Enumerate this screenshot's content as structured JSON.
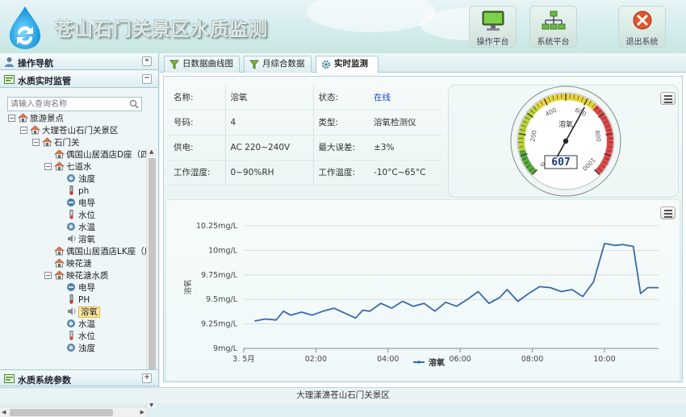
{
  "header": {
    "title": "苍山石门关景区水质监测",
    "buttons": [
      {
        "label": "操作平台",
        "icon": "monitor-icon"
      },
      {
        "label": "系统平台",
        "icon": "network-icon"
      },
      {
        "label": "退出系统",
        "icon": "close-icon"
      }
    ]
  },
  "sidebar": {
    "nav_title": "操作导航",
    "section_title": "水质实时监管",
    "bottom_section_title": "水质系统参数",
    "search_placeholder": "请输入查询名称",
    "tree": [
      {
        "label": "旅游景点",
        "level": 0,
        "toggle": "-",
        "icon": "home-icon"
      },
      {
        "label": "大理苍山石门关景区",
        "level": 1,
        "toggle": "-",
        "icon": "home-icon"
      },
      {
        "label": "石门关",
        "level": 2,
        "toggle": "-",
        "icon": "home-icon"
      },
      {
        "label": "偶国山居酒店D座（四",
        "level": 3,
        "toggle": "",
        "icon": "home-icon"
      },
      {
        "label": "七道水",
        "level": 3,
        "toggle": "-",
        "icon": "home-icon"
      },
      {
        "label": "浊度",
        "level": 4,
        "toggle": "",
        "icon": "turbidity-icon"
      },
      {
        "label": "ph",
        "level": 4,
        "toggle": "",
        "icon": "ph-icon"
      },
      {
        "label": "电导",
        "level": 4,
        "toggle": "",
        "icon": "conductivity-icon"
      },
      {
        "label": "水位",
        "level": 4,
        "toggle": "",
        "icon": "water-level-icon"
      },
      {
        "label": "水温",
        "level": 4,
        "toggle": "",
        "icon": "water-temp-icon"
      },
      {
        "label": "溶氧",
        "level": 4,
        "toggle": "",
        "icon": "oxygen-icon"
      },
      {
        "label": "偶国山居酒店LK座（层",
        "level": 3,
        "toggle": "",
        "icon": "home-icon"
      },
      {
        "label": "映花溏",
        "level": 3,
        "toggle": "",
        "icon": "home-icon"
      },
      {
        "label": "映花溏水质",
        "level": 3,
        "toggle": "-",
        "icon": "home-icon"
      },
      {
        "label": "电导",
        "level": 4,
        "toggle": "",
        "icon": "conductivity-icon"
      },
      {
        "label": "PH",
        "level": 4,
        "toggle": "",
        "icon": "ph-icon"
      },
      {
        "label": "溶氧",
        "level": 4,
        "toggle": "",
        "icon": "oxygen-icon",
        "selected": true
      },
      {
        "label": "水温",
        "level": 4,
        "toggle": "",
        "icon": "water-temp-icon"
      },
      {
        "label": "水位",
        "level": 4,
        "toggle": "",
        "icon": "water-level-icon"
      },
      {
        "label": "浊度",
        "level": 4,
        "toggle": "",
        "icon": "turbidity-icon"
      }
    ]
  },
  "tabs": [
    {
      "label": "日数据曲线图",
      "active": false
    },
    {
      "label": "月综合数据",
      "active": false
    },
    {
      "label": "实时监测",
      "active": true
    }
  ],
  "device_info": [
    {
      "label": "名称:",
      "value": "溶氧",
      "label2": "状态:",
      "value2": "在线"
    },
    {
      "label": "号码:",
      "value": "4",
      "label2": "类型:",
      "value2": "溶氧检测仪"
    },
    {
      "label": "供电:",
      "value": "AC 220~240V",
      "label2": "最大误差:",
      "value2": "±3%"
    },
    {
      "label": "工作湿度:",
      "value": "0~90%RH",
      "label2": "工作温度:",
      "value2": "-10°C~65°C"
    }
  ],
  "colors": {
    "status_online": "#1a3fd6",
    "series_line": "#3a6aa8",
    "accent": "#7fb8c8"
  },
  "gauge": {
    "title": "溶氧",
    "value": 607,
    "value_display": "607",
    "ticks": [
      "0",
      "200",
      "400",
      "600",
      "800",
      "1000"
    ],
    "max": 1000
  },
  "chart_data": {
    "type": "line",
    "title": "",
    "xlabel": "",
    "ylabel": "溶氧",
    "x_ticks": [
      "3. 5月",
      "02:00",
      "04:00",
      "06:00",
      "08:00",
      "10:00"
    ],
    "y_ticks": [
      "9mg/L",
      "9.25mg/L",
      "9.5mg/L",
      "9.75mg/L",
      "10mg/L",
      "10.25mg/L"
    ],
    "ylim": [
      9,
      10.25
    ],
    "xlim_hours": [
      0,
      11.5
    ],
    "series": [
      {
        "name": "溶氧",
        "x": [
          0.3,
          0.6,
          0.9,
          1.1,
          1.3,
          1.6,
          1.9,
          2.2,
          2.5,
          2.8,
          3.1,
          3.3,
          3.5,
          3.8,
          4.1,
          4.4,
          4.7,
          5.0,
          5.3,
          5.6,
          5.9,
          6.2,
          6.5,
          6.8,
          7.1,
          7.3,
          7.6,
          7.9,
          8.2,
          8.5,
          8.8,
          9.1,
          9.4,
          9.7,
          10.0,
          10.3,
          10.5,
          10.8,
          11.0,
          11.2,
          11.5
        ],
        "values": [
          9.28,
          9.3,
          9.29,
          9.38,
          9.34,
          9.37,
          9.34,
          9.38,
          9.41,
          9.36,
          9.31,
          9.39,
          9.38,
          9.46,
          9.41,
          9.48,
          9.43,
          9.46,
          9.38,
          9.47,
          9.43,
          9.5,
          9.58,
          9.46,
          9.52,
          9.6,
          9.48,
          9.56,
          9.63,
          9.62,
          9.58,
          9.6,
          9.53,
          9.68,
          10.07,
          10.05,
          10.06,
          10.04,
          9.56,
          9.62,
          9.62
        ]
      }
    ],
    "legend": "bottom-center",
    "grid": true
  },
  "footer": {
    "text": "大理漾濞苍山石门关景区"
  }
}
